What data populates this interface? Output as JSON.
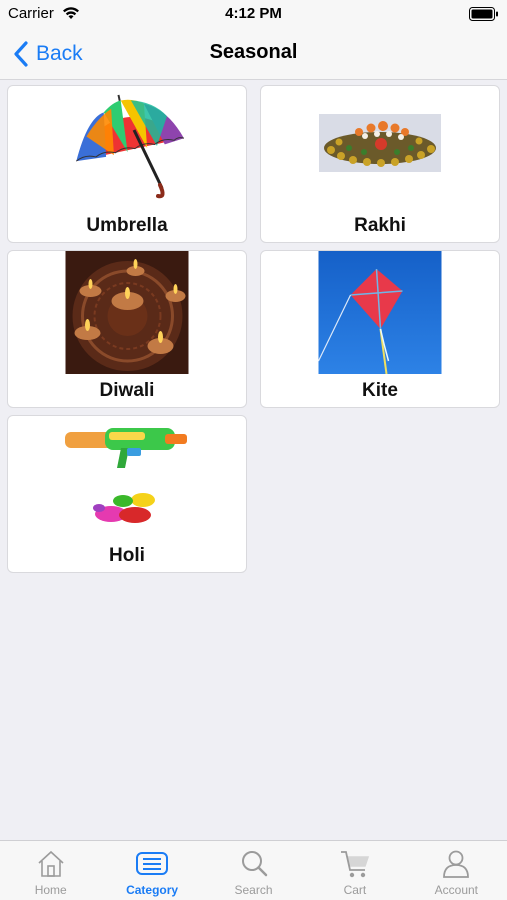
{
  "status_bar": {
    "carrier": "Carrier",
    "time": "4:12 PM"
  },
  "nav": {
    "back_label": "Back",
    "title": "Seasonal"
  },
  "categories": [
    {
      "label": "Umbrella",
      "icon": "umbrella-image"
    },
    {
      "label": "Rakhi",
      "icon": "rakhi-image"
    },
    {
      "label": "Diwali",
      "icon": "diwali-lamps-image"
    },
    {
      "label": "Kite",
      "icon": "kite-image"
    },
    {
      "label": "Holi",
      "icon": "holi-water-gun-image"
    }
  ],
  "tabs": [
    {
      "label": "Home",
      "icon": "home-icon",
      "active": false
    },
    {
      "label": "Category",
      "icon": "category-icon",
      "active": true
    },
    {
      "label": "Search",
      "icon": "search-icon",
      "active": false
    },
    {
      "label": "Cart",
      "icon": "cart-icon",
      "active": false
    },
    {
      "label": "Account",
      "icon": "account-icon",
      "active": false
    }
  ],
  "colors": {
    "accent": "#1a7cf5",
    "inactive": "#9b9b9b",
    "background": "#efeff4"
  }
}
